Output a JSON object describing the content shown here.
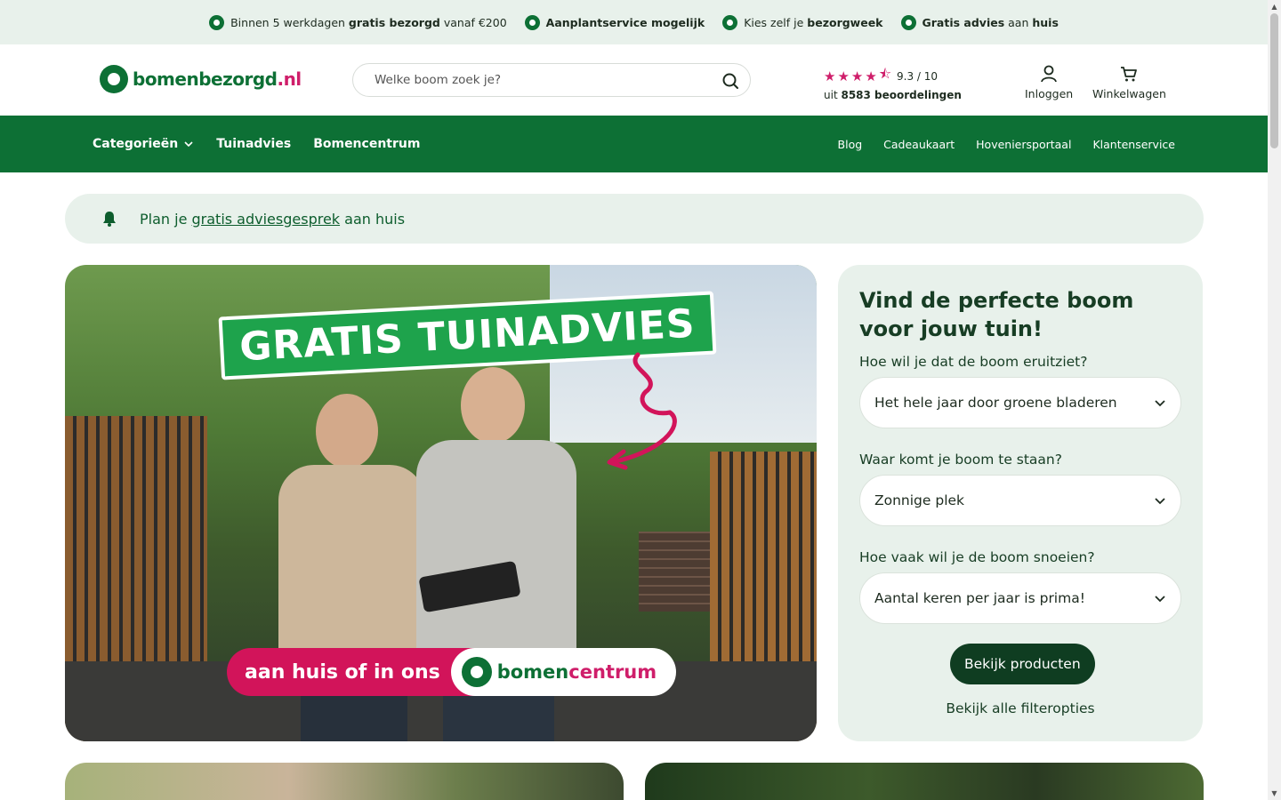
{
  "usp_bar": {
    "items": [
      {
        "pre": "Binnen 5 werkdagen ",
        "bold": "gratis bezorgd",
        "post": " vanaf €200"
      },
      {
        "pre": "",
        "bold": "Aanplantservice mogelijk",
        "post": ""
      },
      {
        "pre": "Kies zelf je ",
        "bold": "bezorgweek",
        "post": ""
      },
      {
        "pre": "",
        "bold": "Gratis advies",
        "post": " aan ",
        "bold2": "huis"
      }
    ]
  },
  "header": {
    "logo": {
      "part1": "bomen",
      "part2": "bezorgd",
      "part3": ".nl"
    },
    "search": {
      "placeholder": "Welke boom zoek je?"
    },
    "rating": {
      "score": "9.3 / 10",
      "count_pre": "uit ",
      "count_bold": "8583 beoordelingen"
    },
    "login_label": "Inloggen",
    "cart_label": "Winkelwagen"
  },
  "nav": {
    "left": [
      {
        "label": "Categorieën"
      },
      {
        "label": "Tuinadvies"
      },
      {
        "label": "Bomencentrum"
      }
    ],
    "right": [
      {
        "label": "Blog"
      },
      {
        "label": "Cadeaukaart"
      },
      {
        "label": "Hoveniersportaal"
      },
      {
        "label": "Klantenservice"
      }
    ]
  },
  "advice_banner": {
    "pre": "Plan je ",
    "link": "gratis adviesgesprek",
    "post": " aan huis"
  },
  "hero": {
    "title": "GRATIS TUINADVIES",
    "bottom_pink": "aan huis of in ons",
    "bottom_logo_green": "bomen",
    "bottom_logo_pink": "centrum"
  },
  "finder": {
    "title": "Vind de perfecte boom voor jouw tuin!",
    "questions": [
      {
        "label": "Hoe wil je dat de boom eruitziet?",
        "value": "Het hele jaar door groene bladeren"
      },
      {
        "label": "Waar komt je boom te staan?",
        "value": "Zonnige plek"
      },
      {
        "label": "Hoe vaak wil je de boom snoeien?",
        "value": "Aantal keren per jaar is prima!"
      }
    ],
    "primary_button": "Bekijk producten",
    "link": "Bekijk alle filteropties"
  },
  "colors": {
    "brand_green": "#0d7035",
    "brand_pink": "#cf1e6a",
    "light_green": "#e8f1eb",
    "dark_green_button": "#0f3d21"
  }
}
